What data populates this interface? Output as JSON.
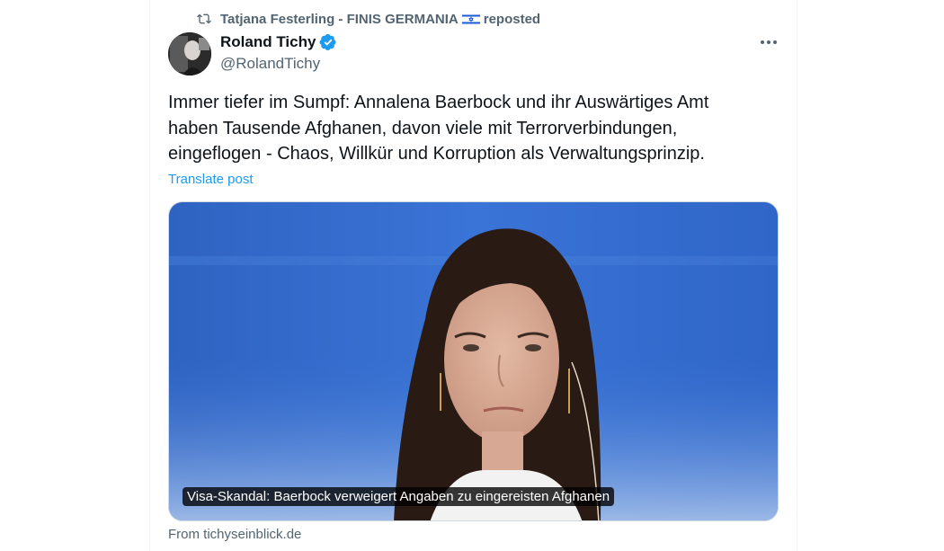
{
  "repost": {
    "text_before_flag": "Tatjana Festerling - FINIS GERMANIA",
    "text_after_flag": "reposted",
    "icon": "repost-icon",
    "flag_icon": "israel-flag-icon"
  },
  "author": {
    "name": "Roland Tichy",
    "handle": "@RolandTichy",
    "verified_icon": "verified-badge-icon",
    "verified_color": "#1d9bf0"
  },
  "post": {
    "lines": [
      "Immer tiefer im Sumpf: Annalena Baerbock und ihr Auswärtiges Amt",
      "haben Tausende Afghanen, davon viele mit Terrorverbindungen,",
      "eingeflogen - Chaos, Willkür  und Korruption als Verwaltungsprinzip."
    ],
    "translate_label": "Translate post"
  },
  "card": {
    "caption": "Visa-Skandal: Baerbock verweigert Angaben zu eingereisten Afghanen",
    "source": "From tichyseinblick.de"
  },
  "colors": {
    "text_primary": "#0f1419",
    "text_secondary": "#536471",
    "link": "#1d9bf0"
  }
}
